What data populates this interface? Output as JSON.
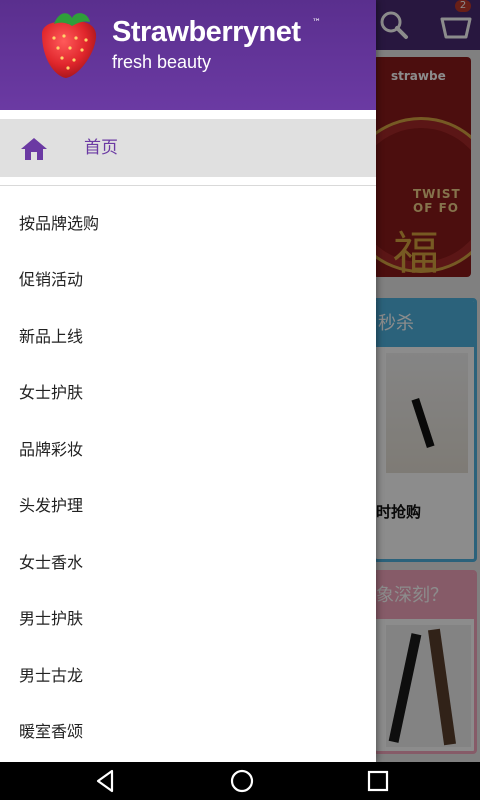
{
  "drawer": {
    "brand_name": "Strawberrynet",
    "brand_tm": "™",
    "brand_tagline": "fresh beauty",
    "home_label": "首页",
    "items": [
      {
        "label": "按品牌选购"
      },
      {
        "label": "促销活动"
      },
      {
        "label": "新品上线"
      },
      {
        "label": "女士护肤"
      },
      {
        "label": "品牌彩妆"
      },
      {
        "label": "头发护理"
      },
      {
        "label": "女士香水"
      },
      {
        "label": "男士护肤"
      },
      {
        "label": "男士古龙"
      },
      {
        "label": "暖室香颂"
      }
    ]
  },
  "background": {
    "cart_count": "2",
    "banner_brand": "strawbe",
    "banner_text": "TWIST OF FO",
    "banner_glyph": "福",
    "flash_title": "秒杀",
    "flash_caption": "时抢购",
    "promo_title": "象深刻？"
  },
  "colors": {
    "purple": "#6b3aa3",
    "header_top": "#5a2f8e",
    "home_bg": "#e0e0e0"
  }
}
